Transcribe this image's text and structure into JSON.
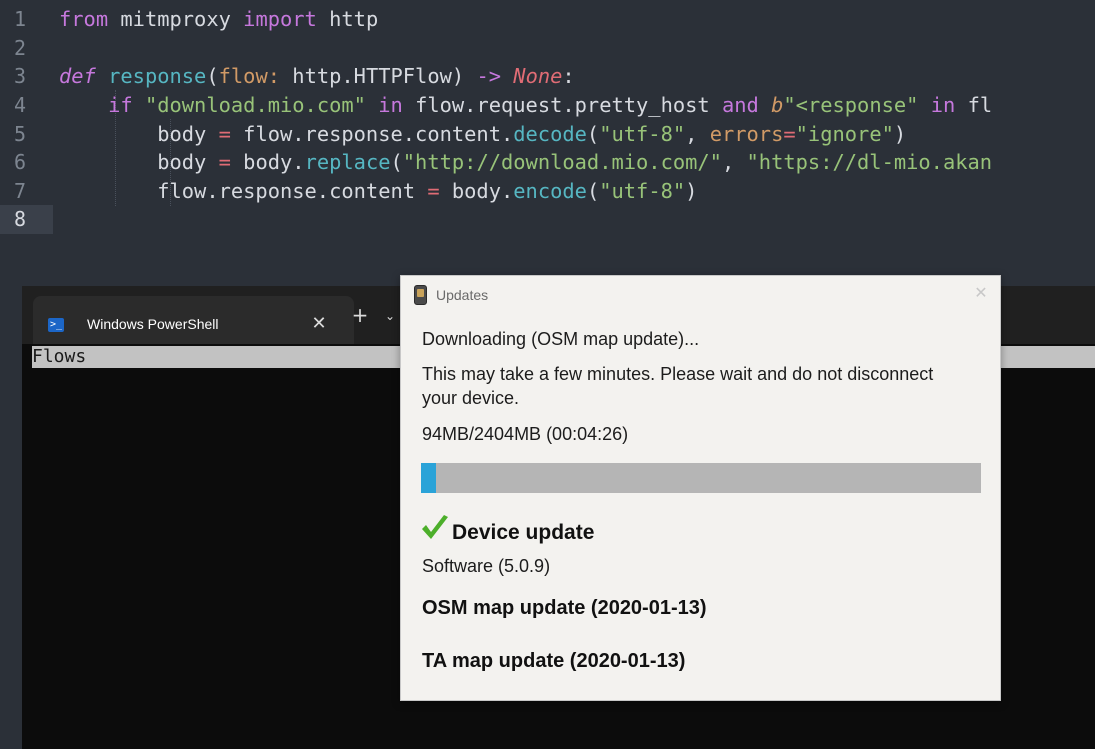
{
  "editor": {
    "lines": [
      {
        "number": "1"
      },
      {
        "number": "2"
      },
      {
        "number": "3"
      },
      {
        "number": "4"
      },
      {
        "number": "5"
      },
      {
        "number": "6"
      },
      {
        "number": "7"
      },
      {
        "number": "8"
      }
    ],
    "current_line": "8",
    "tokens": {
      "l1_from": "from",
      "l1_mod": "mitmproxy",
      "l1_import": "import",
      "l1_name": "http",
      "l3_def": "def",
      "l3_fn": "response",
      "l3_open": "(",
      "l3_param": "flow",
      "l3_colon": ":",
      "l3_type": "http.HTTPFlow",
      "l3_close": ")",
      "l3_arrow": "->",
      "l3_none": "None",
      "l3_end": ":",
      "l4_if": "if",
      "l4_str": "\"download.mio.com\"",
      "l4_in": "in",
      "l4_host": "flow.request.pretty_host",
      "l4_and": "and",
      "l4_b": "b",
      "l4_bstr": "\"<response\"",
      "l4_in2": "in",
      "l4_tail": "fl",
      "l5_body": "body",
      "l5_eq": "=",
      "l5_obj": "flow.response.content.",
      "l5_fn": "decode",
      "l5_open": "(",
      "l5_str": "\"utf-8\"",
      "l5_comma": ",",
      "l5_kw": "errors",
      "l5_eq2": "=",
      "l5_str2": "\"ignore\"",
      "l5_close": ")",
      "l6_body": "body",
      "l6_eq": "=",
      "l6_obj": "body.",
      "l6_fn": "replace",
      "l6_open": "(",
      "l6_str": "\"http://download.mio.com/\"",
      "l6_comma": ",",
      "l6_str2": "\"https://dl-mio.akan",
      "l7_lhs": "flow.response.content",
      "l7_eq": "=",
      "l7_obj": "body.",
      "l7_fn": "encode",
      "l7_open": "(",
      "l7_str": "\"utf-8\"",
      "l7_close": ")"
    }
  },
  "terminal": {
    "tab_title": "Windows PowerShell",
    "tab_icon": "powershell-icon",
    "close_glyph": "✕",
    "new_tab_glyph": "+",
    "dropdown_glyph": "⌄",
    "flows_label": "Flows"
  },
  "dialog": {
    "title": "Updates",
    "close_glyph": "✕",
    "status": "Downloading (OSM map update)...",
    "info": "This may take a few minutes. Please wait and do not disconnect your device.",
    "size": "94MB/2404MB (00:04:26)",
    "progress": 0.0275,
    "progress_color": "#2aa3d8",
    "check_color": "#4caf2a",
    "device_heading": "Device update",
    "software": "Software (5.0.9)",
    "osm_heading": "OSM map update (2020-01-13)",
    "ta_heading": "TA map update (2020-01-13)"
  }
}
